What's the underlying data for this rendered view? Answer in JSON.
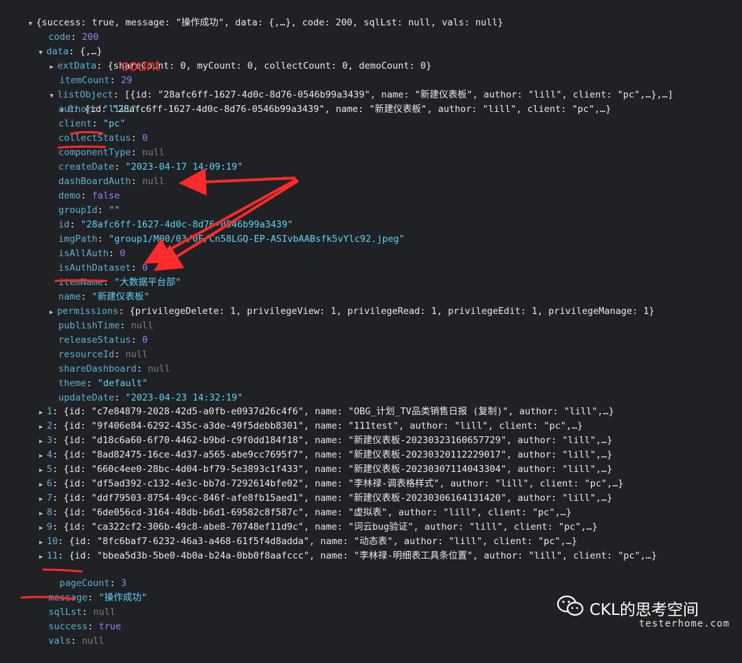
{
  "root": {
    "summary": "{success: true, message: \"操作成功\", data: {,…}, code: 200, sqlLst: null, vals: null}"
  },
  "code": {
    "key": "code",
    "value": "200"
  },
  "data": {
    "key": "data",
    "summary": "{,…}"
  },
  "extData": {
    "key": "extData",
    "summary": "{shareCount: 0, myCount: 0, collectCount: 0, demoCount: 0}"
  },
  "itemCount": {
    "key": "itemCount",
    "value": "29"
  },
  "count_annotation": "count",
  "listObject": {
    "key": "listObject",
    "summary": "[{id: \"28afc6ff-1627-4d0c-8d76-0546b99a3439\", name: \"新建仪表板\", author: \"lill\", client: \"pc\",…},…]"
  },
  "item0": {
    "key": "0",
    "summary": "{id: \"28afc6ff-1627-4d0c-8d76-0546b99a3439\", name: \"新建仪表板\", author: \"lill\", client: \"pc\",…}"
  },
  "fields": [
    {
      "key": "author",
      "value": "\"lill\"",
      "type": "s"
    },
    {
      "key": "client",
      "value": "\"pc\"",
      "type": "s"
    },
    {
      "key": "collectStatus",
      "value": "0",
      "type": "n"
    },
    {
      "key": "componentType",
      "value": "null",
      "type": "nl"
    },
    {
      "key": "createDate",
      "value": "\"2023-04-17 14:09:19\"",
      "type": "s"
    },
    {
      "key": "dashBoardAuth",
      "value": "null",
      "type": "nl"
    },
    {
      "key": "demo",
      "value": "false",
      "type": "b"
    },
    {
      "key": "groupId",
      "value": "\"\"",
      "type": "s"
    },
    {
      "key": "id",
      "value": "\"28afc6ff-1627-4d0c-8d76-0546b99a3439\"",
      "type": "s"
    },
    {
      "key": "imgPath",
      "value": "\"group1/M00/03/0F/Cn58LGQ-EP-ASIvbAABsfk5vYlc92.jpeg\"",
      "type": "s"
    },
    {
      "key": "isAllAuth",
      "value": "0",
      "type": "n"
    },
    {
      "key": "isAuthDataset",
      "value": "0",
      "type": "n"
    },
    {
      "key": "itemName",
      "value": "\"大数据平台部\"",
      "type": "s"
    },
    {
      "key": "name",
      "value": "\"新建仪表板\"",
      "type": "s"
    },
    {
      "key": "permissions",
      "value": "{privilegeDelete: 1, privilegeView: 1, privilegeRead: 1, privilegeEdit: 1, privilegeManage: 1}",
      "type": "p",
      "expandable": true
    },
    {
      "key": "publishTime",
      "value": "null",
      "type": "nl"
    },
    {
      "key": "releaseStatus",
      "value": "0",
      "type": "n"
    },
    {
      "key": "resourceId",
      "value": "null",
      "type": "nl"
    },
    {
      "key": "shareDashboard",
      "value": "null",
      "type": "nl"
    },
    {
      "key": "theme",
      "value": "\"default\"",
      "type": "s"
    },
    {
      "key": "updateDate",
      "value": "\"2023-04-23 14:32:19\"",
      "type": "s"
    }
  ],
  "items": [
    {
      "key": "1",
      "summary": "{id: \"c7e84879-2028-42d5-a0fb-e0937d26c4f6\", name: \"OBG_计划_TV品类销售日报 (复制)\", author: \"lill\",…}"
    },
    {
      "key": "2",
      "summary": "{id: \"9f406e84-6292-435c-a3de-49f5debb8301\", name: \"111test\", author: \"lill\", client: \"pc\",…}"
    },
    {
      "key": "3",
      "summary": "{id: \"d18c6a60-6f70-4462-b9bd-c9f0dd184f18\", name: \"新建仪表板-20230323160657729\", author: \"lill\",…}"
    },
    {
      "key": "4",
      "summary": "{id: \"8ad82475-16ce-4d37-a565-abe9cc7695f7\", name: \"新建仪表板-20230320112229017\", author: \"lill\",…}"
    },
    {
      "key": "5",
      "summary": "{id: \"660c4ee0-28bc-4d04-bf79-5e3893c1f433\", name: \"新建仪表板-20230307114043304\", author: \"lill\",…}"
    },
    {
      "key": "6",
      "summary": "{id: \"df5ad392-c132-4e3c-bb7d-7292614bfe02\", name: \"李林禄-调表格样式\", author: \"lill\", client: \"pc\",…}"
    },
    {
      "key": "7",
      "summary": "{id: \"ddf79503-8754-49cc-846f-afe8fb15aed1\", name: \"新建仪表板-20230306164131420\", author: \"lill\",…}"
    },
    {
      "key": "8",
      "summary": "{id: \"6de056cd-3164-48db-b6d1-69582c8f587c\", name: \"虚拟表\", author: \"lill\", client: \"pc\",…}"
    },
    {
      "key": "9",
      "summary": "{id: \"ca322cf2-306b-49c8-abe8-70748ef11d9c\", name: \"词云bug验证\", author: \"lill\", client: \"pc\",…}"
    },
    {
      "key": "10",
      "summary": "{id: \"8fc6baf7-6232-46a3-a468-61f5f4d8adda\", name: \"动态表\", author: \"lill\", client: \"pc\",…}"
    },
    {
      "key": "11",
      "summary": "{id: \"bbea5d3b-5be0-4b0a-b24a-0bb0f8aafccc\", name: \"李林禄-明细表工具条位置\", author: \"lill\", client: \"pc\",…}"
    }
  ],
  "pageCount": {
    "key": "pageCount",
    "value": "3"
  },
  "message": {
    "key": "message",
    "value": "\"操作成功\""
  },
  "sqlLst": {
    "key": "sqlLst",
    "value": "null"
  },
  "success": {
    "key": "success",
    "value": "true"
  },
  "vals": {
    "key": "vals",
    "value": "null"
  },
  "watermark": {
    "brand": "CKL的思考空间",
    "site": "testerhome.com"
  },
  "colors": {
    "background": "#202124",
    "key": "#5db0d7",
    "string": "#5cd5fb",
    "number": "#9980ff",
    "null": "#7f7f7f",
    "annotation": "#ff2a2a"
  }
}
